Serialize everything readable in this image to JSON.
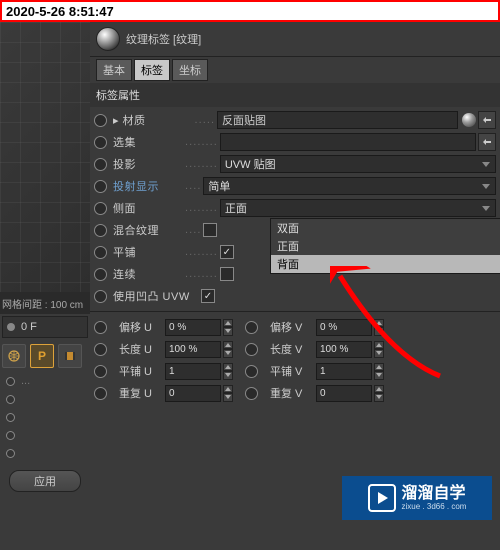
{
  "timestamp": "2020-5-26 8:51:47",
  "viewport": {
    "grid_info": "网格间距 : 100 cm"
  },
  "bottom_left": {
    "temp_label": "0 F",
    "apply_btn": "应用"
  },
  "panel": {
    "title": "纹理标签 [纹理]",
    "tabs": {
      "basic": "基本",
      "tag": "标签",
      "coord": "坐标"
    },
    "section": "标签属性",
    "props": {
      "material": {
        "label": "材质",
        "value": "反面贴图"
      },
      "selection": {
        "label": "选集",
        "value": ""
      },
      "projection": {
        "label": "投影",
        "value": "UVW 贴图"
      },
      "proj_display": {
        "label": "投射显示",
        "value": "简单"
      },
      "side": {
        "label": "侧面",
        "value": "正面"
      },
      "mix_texture": {
        "label": "混合纹理"
      },
      "tile": {
        "label": "平铺"
      },
      "continuous": {
        "label": "连续"
      },
      "use_uvw": {
        "label": "使用凹凸 UVW"
      }
    },
    "dropdown": {
      "opt1": "双面",
      "opt2": "正面",
      "opt3": "背面"
    },
    "uv": {
      "offset_u": {
        "label": "偏移 U",
        "value": "0 %"
      },
      "offset_v": {
        "label": "偏移 V",
        "value": "0 %"
      },
      "length_u": {
        "label": "长度 U",
        "value": "100 %"
      },
      "length_v": {
        "label": "长度 V",
        "value": "100 %"
      },
      "tile_u": {
        "label": "平铺 U",
        "value": "1"
      },
      "tile_v": {
        "label": "平铺 V",
        "value": "1"
      },
      "repeat_u": {
        "label": "重复 U",
        "value": "0"
      },
      "repeat_v": {
        "label": "重复 V",
        "value": "0"
      }
    }
  },
  "watermark": {
    "main": "溜溜自学",
    "sub": "zixue . 3d66 . com"
  }
}
